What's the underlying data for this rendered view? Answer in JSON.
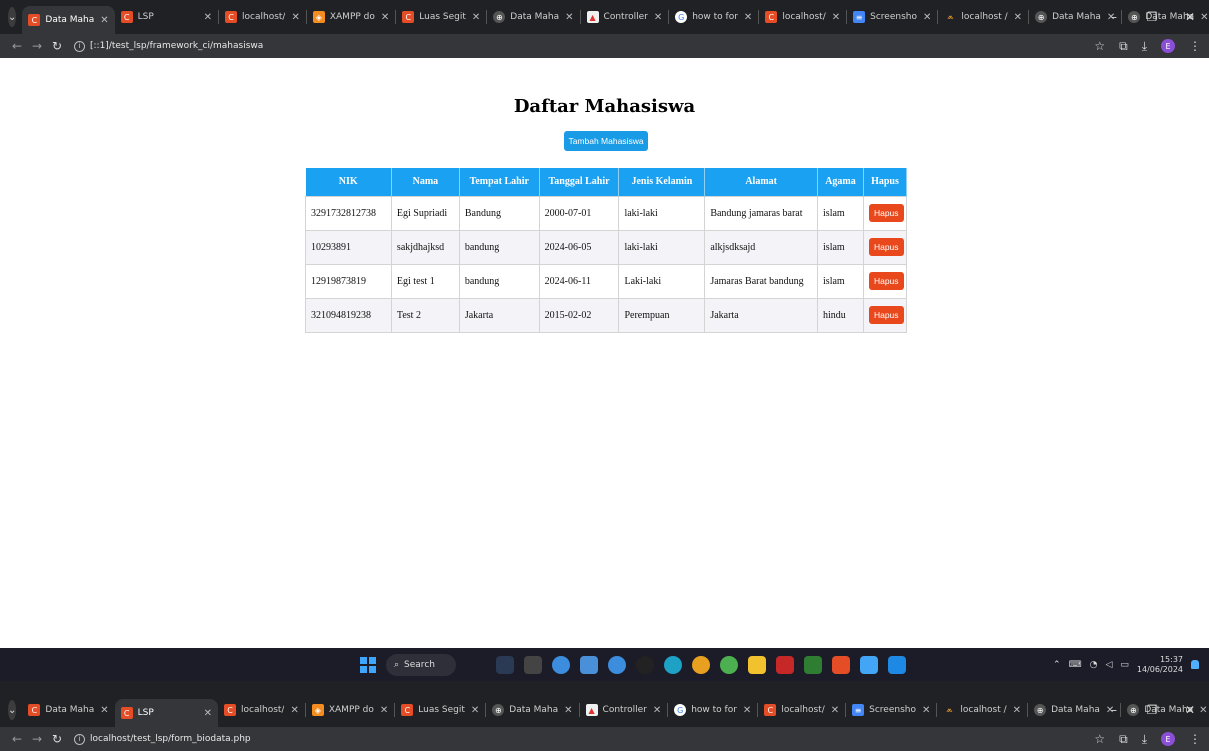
{
  "browser_top": {
    "tabs": [
      {
        "label": "Data Maha",
        "active": true
      },
      {
        "label": "LSP"
      },
      {
        "label": "localhost/"
      },
      {
        "label": "XAMPP do"
      },
      {
        "label": "Luas Segit"
      },
      {
        "label": "Data Maha"
      },
      {
        "label": "Controller"
      },
      {
        "label": "how to for"
      },
      {
        "label": "localhost/"
      },
      {
        "label": "Screensho"
      },
      {
        "label": "localhost /"
      },
      {
        "label": "Data Maha"
      },
      {
        "label": "Data Maha"
      }
    ],
    "url": "[::1]/test_lsp/framework_ci/mahasiswa"
  },
  "page": {
    "title": "Daftar Mahasiswa",
    "add_button": "Tambah Mahasiswa",
    "columns": [
      "NIK",
      "Nama",
      "Tempat Lahir",
      "Tanggal Lahir",
      "Jenis Kelamin",
      "Alamat",
      "Agama",
      "Hapus"
    ],
    "rows": [
      {
        "nik": "3291732812738",
        "nama": "Egi Supriadi",
        "tempat": "Bandung",
        "tanggal": "2000-07-01",
        "jk": "laki-laki",
        "alamat": "Bandung jamaras barat",
        "agama": "islam",
        "hapus": "Hapus"
      },
      {
        "nik": "10293891",
        "nama": "sakjdhajksd",
        "tempat": "bandung",
        "tanggal": "2024-06-05",
        "jk": "laki-laki",
        "alamat": "alkjsdksajd",
        "agama": "islam",
        "hapus": "Hapus"
      },
      {
        "nik": "12919873819",
        "nama": "Egi test 1",
        "tempat": "bandung",
        "tanggal": "2024-06-11",
        "jk": "Laki-laki",
        "alamat": "Jamaras Barat bandung",
        "agama": "islam",
        "hapus": "Hapus"
      },
      {
        "nik": "321094819238",
        "nama": "Test 2",
        "tempat": "Jakarta",
        "tanggal": "2015-02-02",
        "jk": "Perempuan",
        "alamat": "Jakarta",
        "agama": "hindu",
        "hapus": "Hapus"
      }
    ]
  },
  "taskbar": {
    "search": "Search",
    "time": "15:37",
    "date": "14/06/2024"
  },
  "browser_bottom": {
    "tabs": [
      {
        "label": "Data Maha"
      },
      {
        "label": "LSP",
        "active": true
      },
      {
        "label": "localhost/"
      },
      {
        "label": "XAMPP do"
      },
      {
        "label": "Luas Segit"
      },
      {
        "label": "Data Maha"
      },
      {
        "label": "Controller"
      },
      {
        "label": "how to for"
      },
      {
        "label": "localhost/"
      },
      {
        "label": "Screensho"
      },
      {
        "label": "localhost /"
      },
      {
        "label": "Data Maha"
      },
      {
        "label": "Data Maha"
      }
    ],
    "url": "localhost/test_lsp/form_biodata.php"
  },
  "colors": {
    "header_blue": "#1ba1f2",
    "add_button": "#1a9be6",
    "delete_button": "#e8481c"
  }
}
